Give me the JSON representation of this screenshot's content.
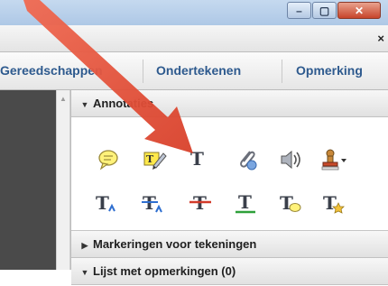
{
  "window": {
    "minimize_label": "–",
    "maximize_label": "▢",
    "close_label": "✕"
  },
  "menubar": {
    "close_label": "×"
  },
  "toolbar": {
    "tabs": [
      {
        "label": "Gereedschappen"
      },
      {
        "label": "Ondertekenen"
      },
      {
        "label": "Opmerking"
      }
    ]
  },
  "panel": {
    "annotations_title": "Annotaties",
    "markup_title": "Markeringen voor tekeningen",
    "comments_title": "Lijst met opmerkingen (0)"
  },
  "tools": {
    "row1": [
      "sticky-note-icon",
      "highlight-text-icon",
      "add-text-icon",
      "attach-file-icon",
      "record-audio-icon",
      "stamp-icon"
    ],
    "row2": [
      "insert-text-icon",
      "replace-text-icon",
      "strikethrough-icon",
      "underline-icon",
      "text-comment-icon",
      "text-note-icon"
    ],
    "text_glyph": "T"
  },
  "colors": {
    "arrow": "#e8503a",
    "tab_text": "#2e5a8e",
    "left_pane": "#4a4a4a"
  }
}
